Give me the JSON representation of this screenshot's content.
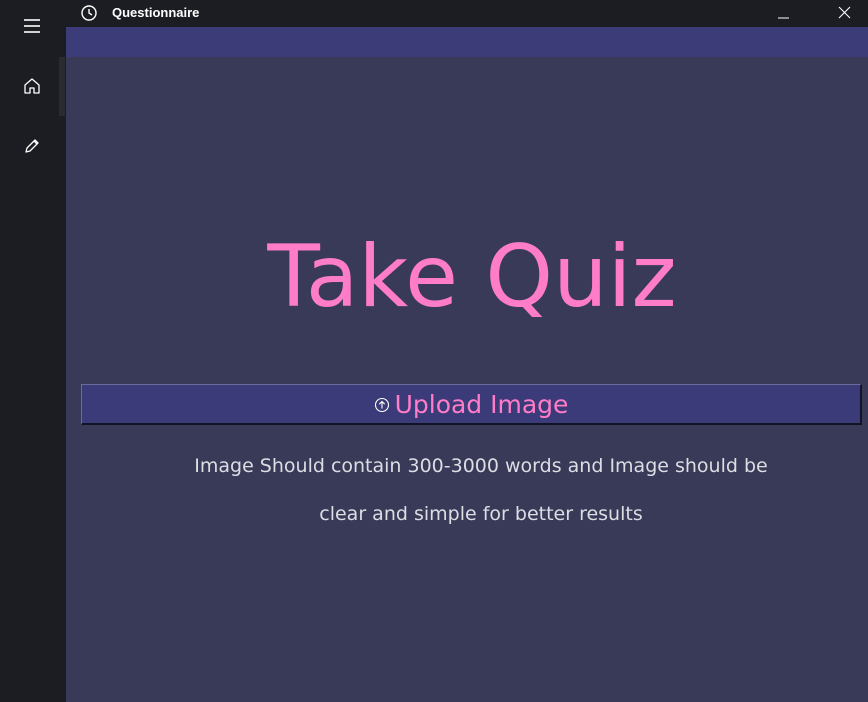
{
  "window": {
    "title": "Questionnaire",
    "controls": [
      "minimize",
      "close"
    ]
  },
  "sidebar": {
    "items": [
      {
        "name": "menu",
        "icon": "hamburger-icon"
      },
      {
        "name": "home",
        "icon": "home-icon"
      },
      {
        "name": "edit",
        "icon": "pencil-icon"
      }
    ]
  },
  "main": {
    "heading": "Take Quiz",
    "upload_button": {
      "label": "Upload Image",
      "icon": "upload-arrow-icon"
    },
    "description": {
      "line1": "Image Should contain 300-3000 words and Image should be",
      "line2": "clear and simple for better results"
    }
  },
  "colors": {
    "accent_pink": "#ff7cc8",
    "main_bg": "#383a58",
    "button_bg": "#3a3b78",
    "sidebar_bg": "#1c1d22",
    "text_light": "#dddde4"
  }
}
